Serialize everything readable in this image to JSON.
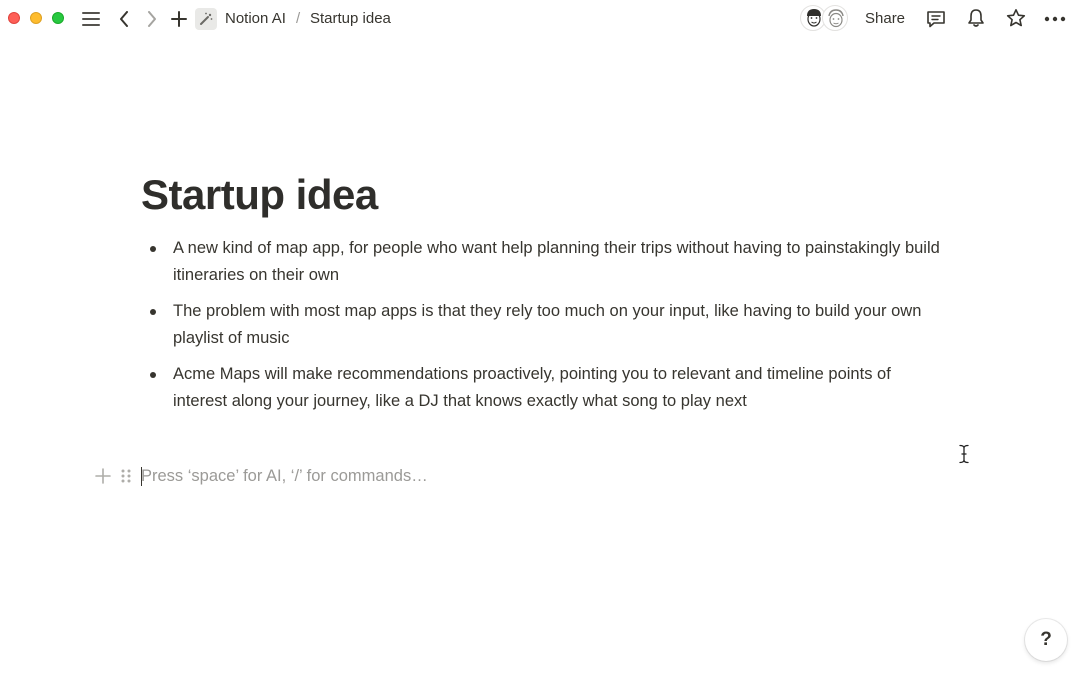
{
  "window": {
    "traffic_lights": [
      "close",
      "minimize",
      "zoom"
    ]
  },
  "topbar": {
    "icons": {
      "sidebar": "hamburger-menu-icon",
      "back": "chevron-left-icon",
      "forward": "chevron-right-icon",
      "new": "plus-icon",
      "page": "magic-wand-icon"
    },
    "breadcrumb": {
      "parent": "Notion AI",
      "separator": "/",
      "current": "Startup idea"
    },
    "share_label": "Share",
    "right_icons": [
      "comment-icon",
      "bell-icon",
      "star-icon",
      "more-icon"
    ]
  },
  "page": {
    "title": "Startup idea",
    "bullets": [
      {
        "text": "A new kind of map app, for people who want help planning their trips without having to painstakingly build itineraries on their own"
      },
      {
        "text": "The problem with most map apps is that they rely too much on your input, like having to build your own playlist of music"
      },
      {
        "text": "Acme Maps will make recommendations proactively, pointing you to relevant and timeline points of interest along your journey, like a DJ that knows exactly what song to play next"
      }
    ],
    "new_block": {
      "placeholder": "Press ‘space’ for AI, ‘/’ for commands…"
    }
  },
  "help": {
    "label": "?"
  }
}
